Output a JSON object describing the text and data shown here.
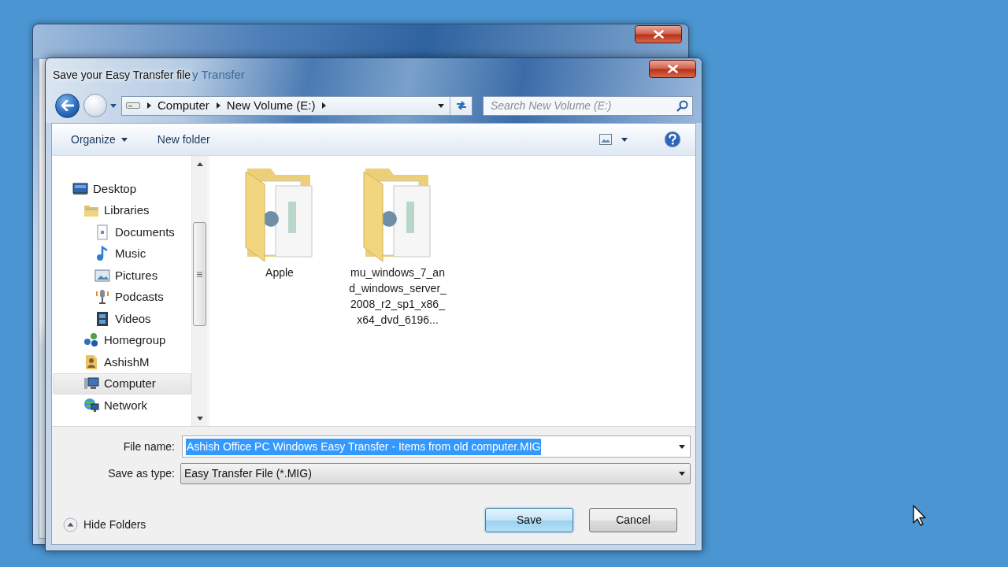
{
  "background_window": {
    "title_fragment": "y Transfer"
  },
  "dialog": {
    "title": "Save your Easy Transfer file"
  },
  "address_bar": {
    "path": [
      "Computer",
      "New Volume (E:)"
    ]
  },
  "search": {
    "placeholder": "Search New Volume (E:)"
  },
  "toolbar": {
    "items": [
      {
        "label": "Organize",
        "kind": "menu"
      },
      {
        "label": "New folder",
        "kind": "button"
      }
    ]
  },
  "navigation_pane": {
    "items": [
      {
        "label": "Desktop",
        "kind": "desktop",
        "selected": false,
        "children": [
          {
            "label": "Libraries",
            "kind": "libraries",
            "selected": false,
            "children": [
              {
                "label": "Documents",
                "kind": "documents",
                "selected": false
              },
              {
                "label": "Music",
                "kind": "music",
                "selected": false
              },
              {
                "label": "Pictures",
                "kind": "pictures",
                "selected": false
              },
              {
                "label": "Podcasts",
                "kind": "podcasts",
                "selected": false
              },
              {
                "label": "Videos",
                "kind": "videos",
                "selected": false
              }
            ]
          },
          {
            "label": "Homegroup",
            "kind": "homegroup",
            "selected": false
          },
          {
            "label": "AshishM",
            "kind": "user",
            "selected": false
          },
          {
            "label": "Computer",
            "kind": "computer",
            "selected": true
          },
          {
            "label": "Network",
            "kind": "network",
            "selected": false
          }
        ]
      }
    ]
  },
  "files": [
    {
      "name": "Apple"
    },
    {
      "name": "mu_windows_7_and_windows_server_2008_r2_sp1_x86_x64_dvd_6196..."
    }
  ],
  "file_name": {
    "label": "File name:",
    "value": "Ashish Office PC Windows Easy Transfer - Items from old computer.MIG",
    "value_selected": true
  },
  "save_as_type": {
    "label": "Save as type:",
    "value": "Easy Transfer File (*.MIG)"
  },
  "hide_folders": {
    "label": "Hide Folders"
  },
  "buttons": [
    {
      "label": "Save",
      "default": true
    },
    {
      "label": "Cancel",
      "default": false
    }
  ]
}
